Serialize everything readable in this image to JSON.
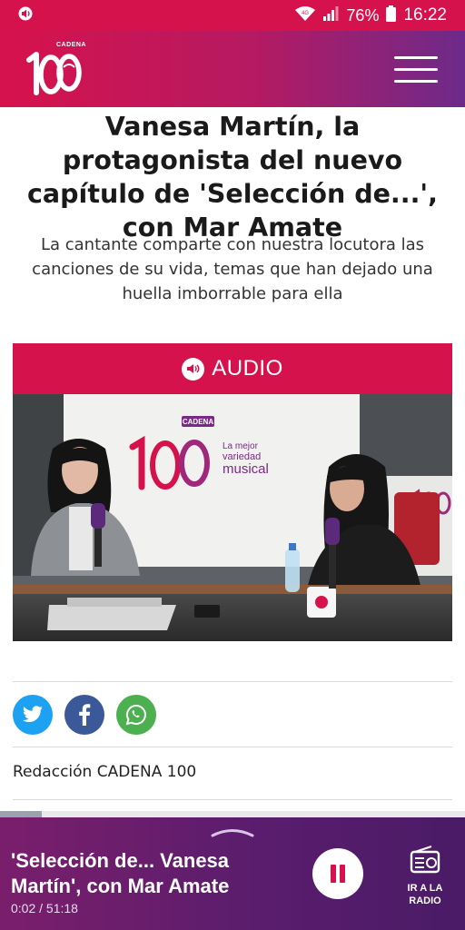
{
  "status_bar": {
    "battery": "76%",
    "time": "16:22"
  },
  "header": {
    "logo_text": "100",
    "logo_badge": "CADENA"
  },
  "article": {
    "headline": "Vanesa Martín, la protagonista del nuevo capítulo de 'Selección de...', con Mar Amate",
    "subheadline": "La cantante comparte con nuestra locutora las canciones de su vida, temas que han dejado una huella imborrable para ella",
    "audio_label": "AUDIO",
    "photo_signage": {
      "badge": "CADENA",
      "number": "100",
      "tagline_line1": "La mejor",
      "tagline_line2": "variedad",
      "tagline_line3": "musical"
    },
    "share": [
      "twitter",
      "facebook",
      "whatsapp"
    ],
    "author": "Redacción CADENA 100"
  },
  "player": {
    "title": "'Selección de... Vanesa Martín', con Mar Amate",
    "current_time": "0:02",
    "duration": "51:18",
    "time_display": "0:02 / 51:18",
    "progress": 0.09,
    "radio_label_line1": "IR A LA",
    "radio_label_line2": "RADIO"
  },
  "colors": {
    "brand": "#d6124c",
    "player_bg": "#5a1d6d",
    "twitter": "#1da1f2",
    "facebook": "#3b5998",
    "whatsapp": "#4caf50"
  }
}
